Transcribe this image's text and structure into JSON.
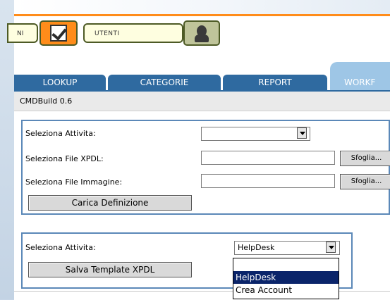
{
  "modules": {
    "first_label": "NI",
    "utenti_label": "UTENTI"
  },
  "tabs": [
    {
      "label": "LOOKUP"
    },
    {
      "label": "CATEGORIE"
    },
    {
      "label": "REPORT"
    },
    {
      "label": "WORKF"
    }
  ],
  "version": "CMDBuild 0.6",
  "form1": {
    "activity_label": "Seleziona Attivita:",
    "activity_value": "",
    "xpdl_label": "Seleziona File XPDL:",
    "xpdl_value": "",
    "image_label": "Seleziona File Immagine:",
    "image_value": "",
    "browse1": "Sfoglia...",
    "browse2": "Sfoglia...",
    "load_button": "Carica Definizione"
  },
  "form2": {
    "activity_label": "Seleziona Attivita:",
    "activity_value": "HelpDesk",
    "save_button": "Salva Template XPDL",
    "dropdown_options": [
      "",
      "HelpDesk",
      "Crea Account"
    ],
    "selected_option": "HelpDesk"
  },
  "colors": {
    "accent_orange": "#ff8c1a",
    "tab_blue": "#2f6aa0",
    "active_tab": "#9ec6e6",
    "panel_border": "#5b88b8",
    "selection": "#0a246a"
  }
}
